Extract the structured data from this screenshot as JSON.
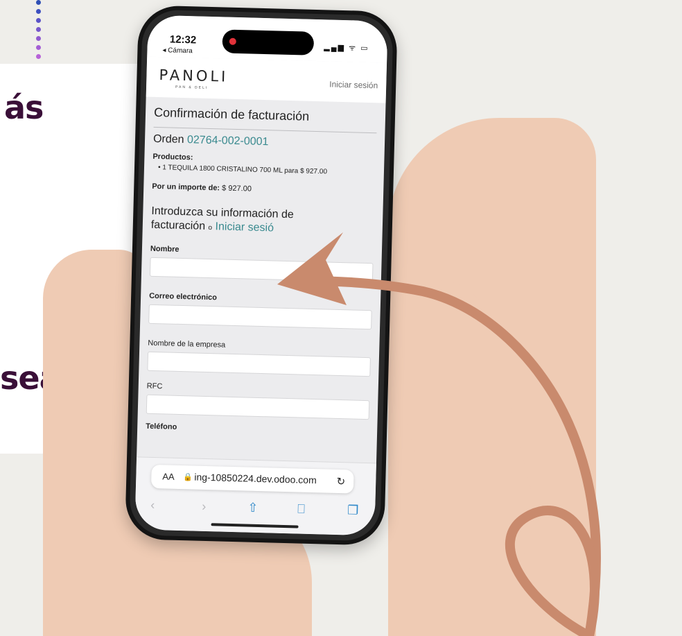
{
  "side": {
    "text_top": "ás",
    "text_bottom": "sea"
  },
  "status": {
    "time": "12:32",
    "back": "◂ Cámara",
    "signal_icons": "▂▄▆ ᯤ ▭"
  },
  "site": {
    "logo": "PANOLI",
    "logo_sub": "PAN & DELI",
    "login": "Iniciar sesión"
  },
  "page": {
    "title": "Confirmación de facturación",
    "order_prefix": "Orden",
    "order_number": "02764-002-0001",
    "products_label": "Productos:",
    "product_line": "• 1 TEQUILA 1800 CRISTALINO 700 ML para $ 927.00",
    "amount_label": "Por un importe de:",
    "amount_value": "$ 927.00",
    "section_title_1": "Introduzca su información de",
    "section_title_2": "facturación",
    "section_or": "o",
    "section_login": "Iniciar sesió"
  },
  "form": {
    "name_label": "Nombre",
    "email_label": "Correo electrónico",
    "company_label": "Nombre de la empresa",
    "rfc_label": "RFC",
    "phone_label": "Teléfono"
  },
  "browser": {
    "aa": "AA",
    "url": "ing-10850224.dev.odoo.com",
    "reload": "↻"
  },
  "nav": {
    "back": "‹",
    "forward": "›",
    "share": "⇧",
    "bookmarks": "⎕",
    "tabs": "❐"
  },
  "colors": {
    "accent": "#3a8a8f",
    "arrow": "#c98a6d",
    "side_text": "#3a0f38"
  }
}
